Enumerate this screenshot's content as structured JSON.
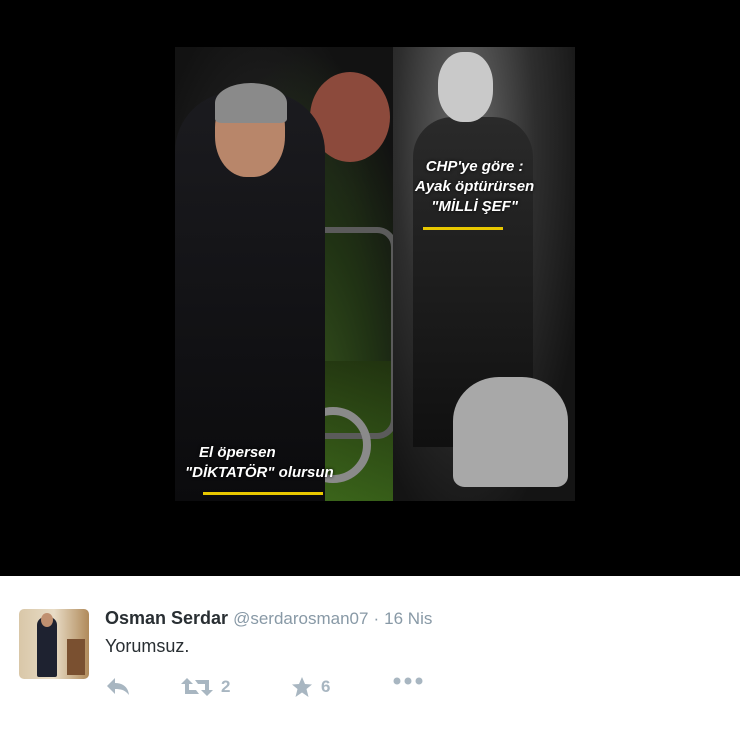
{
  "media": {
    "caption_left": {
      "line1": "El öpersen",
      "line2": "\"DİKTATÖR\" olursun"
    },
    "caption_right": {
      "line1": "CHP'ye göre :",
      "line2": "Ayak öptürürsen",
      "line3": "\"MİLLİ ŞEF\""
    },
    "underline_color": "#e8c800"
  },
  "tweet": {
    "author_name": "Osman Serdar",
    "handle": "@serdarosman07",
    "separator": "·",
    "time": "16 Nis",
    "text": "Yorumsuz.",
    "actions": {
      "reply_icon": "reply-icon",
      "retweet_icon": "retweet-icon",
      "retweet_count": "2",
      "favorite_icon": "star-icon",
      "favorite_count": "6",
      "more_icon": "more-dots-icon"
    }
  },
  "colors": {
    "name": "#292f33",
    "meta": "#8899a6",
    "action": "#a8b6c1",
    "background": "#000000"
  }
}
